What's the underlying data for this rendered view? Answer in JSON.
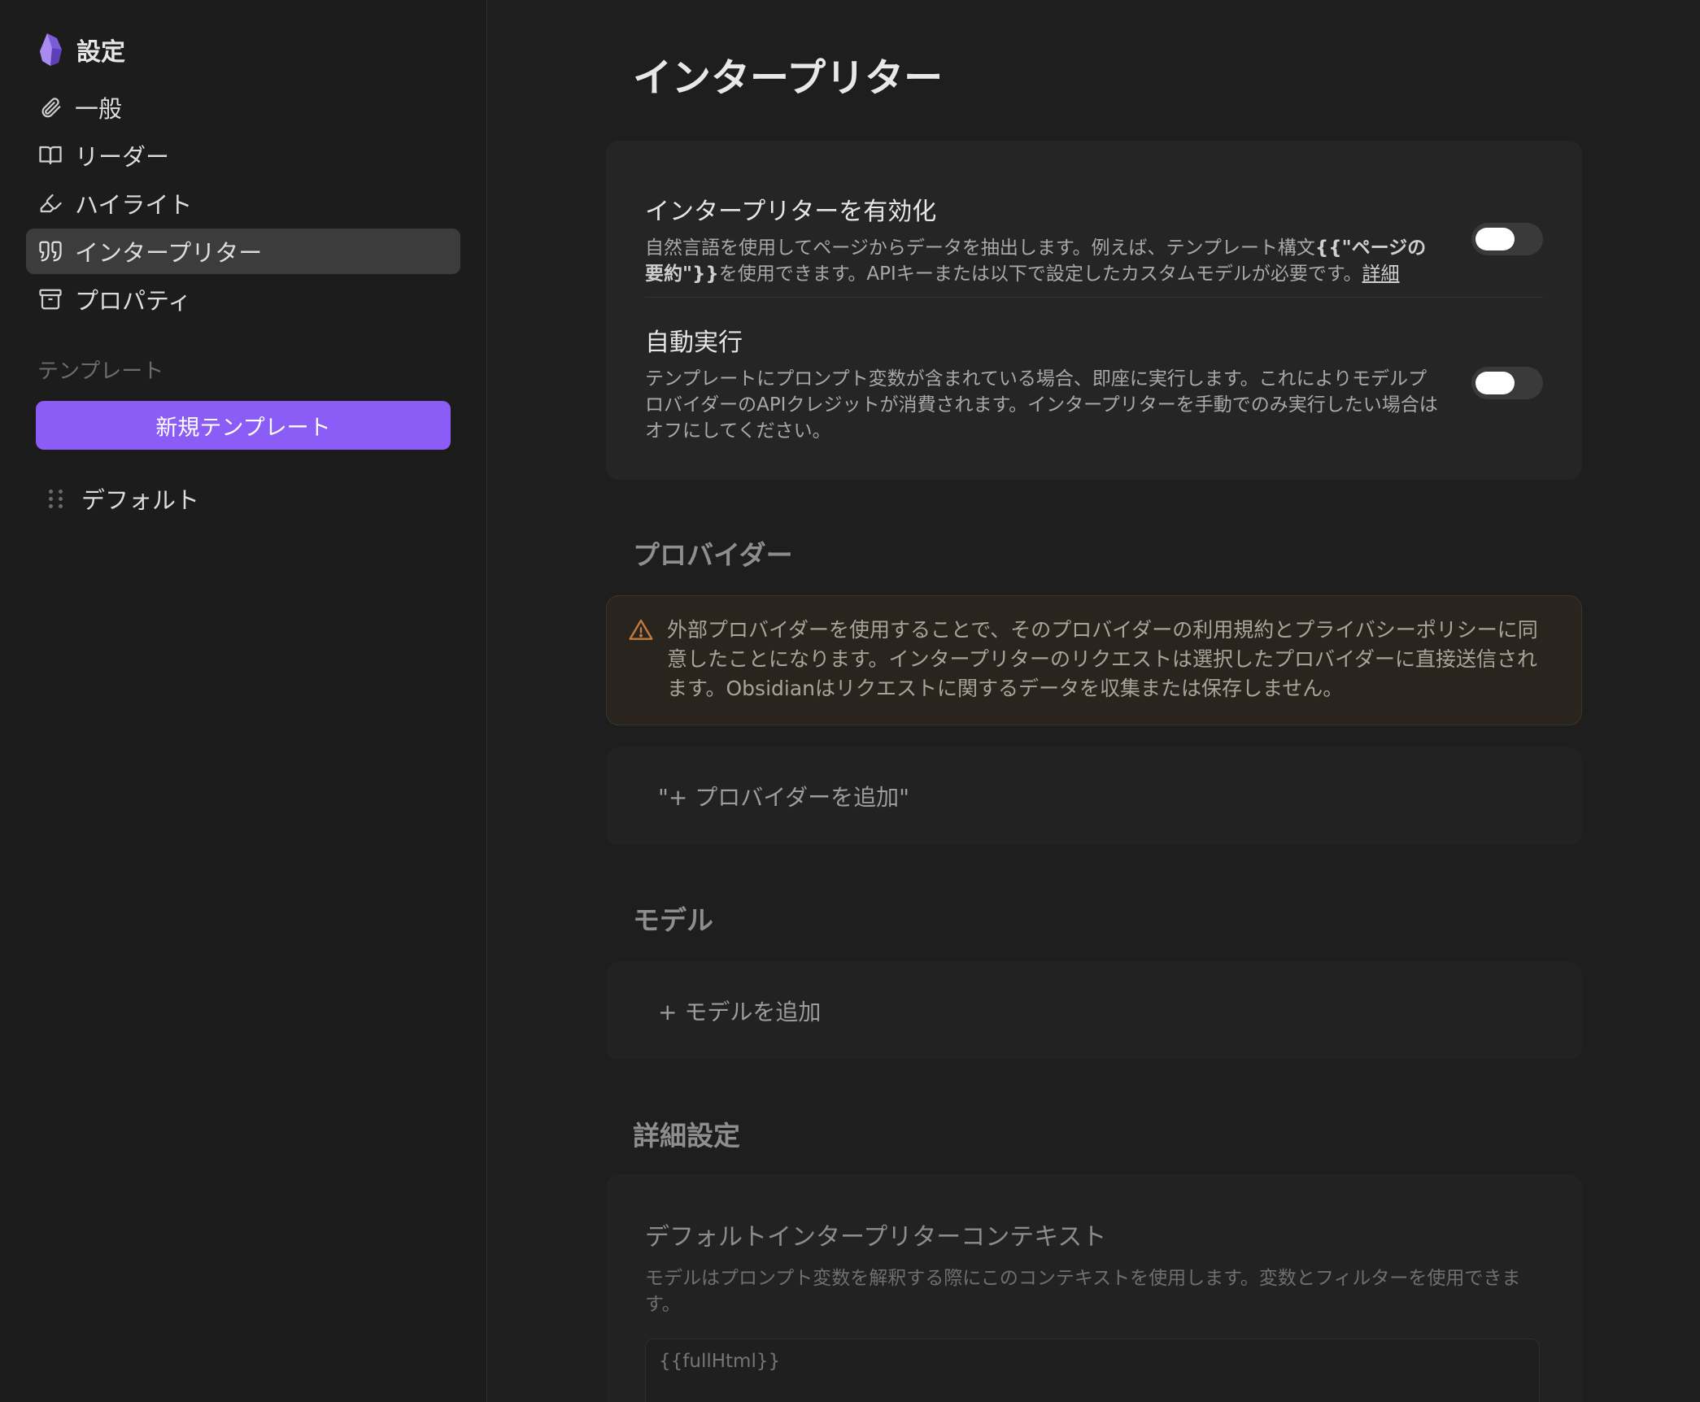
{
  "sidebar": {
    "title": "設定",
    "items": [
      {
        "label": "一般",
        "icon": "paperclip-icon"
      },
      {
        "label": "リーダー",
        "icon": "book-open-icon"
      },
      {
        "label": "ハイライト",
        "icon": "highlighter-icon"
      },
      {
        "label": "インタープリター",
        "icon": "quote-icon"
      },
      {
        "label": "プロパティ",
        "icon": "archive-icon"
      }
    ],
    "active_item": "インタープリター",
    "templates_label": "テンプレート",
    "new_template_label": "新規テンプレート",
    "templates": [
      "デフォルト"
    ]
  },
  "main": {
    "title": "インタープリター",
    "settings": [
      {
        "name": "インタープリターを有効化",
        "desc_prefix": "自然言語を使用してページからデータを抽出します。例えば、テンプレート構文",
        "desc_bold": "{{\"ページの要約\"}}",
        "desc_suffix": "を使用できます。APIキーまたは以下で設定したカスタムモデルが必要です。",
        "desc_link": "詳細",
        "enabled": false
      },
      {
        "name": "自動実行",
        "desc": "テンプレートにプロンプト変数が含まれている場合、即座に実行します。これによりモデルプロバイダーのAPIクレジットが消費されます。インタープリターを手動でのみ実行したい場合はオフにしてください。",
        "enabled": false
      }
    ],
    "providers": {
      "title": "プロバイダー",
      "warning": "外部プロバイダーを使用することで、そのプロバイダーの利用規約とプライバシーポリシーに同意したことになります。インタープリターのリクエストは選択したプロバイダーに直接送信されます。Obsidianはリクエストに関するデータを収集または保存しません。",
      "add_label": "\"+ プロバイダーを追加\""
    },
    "models": {
      "title": "モデル",
      "add_label": "+ モデルを追加"
    },
    "advanced": {
      "title": "詳細設定",
      "context_name": "デフォルトインタープリターコンテキスト",
      "context_desc": "モデルはプロンプト変数を解釈する際にこのコンテキストを使用します。変数とフィルターを使用できます。",
      "context_placeholder": "{{fullHtml}}"
    }
  },
  "colors": {
    "accent": "#8b5cf6",
    "background": "#1e1e1e",
    "card": "#252525",
    "warning_bg": "#2a241f",
    "warning_icon": "#c07a3e"
  }
}
